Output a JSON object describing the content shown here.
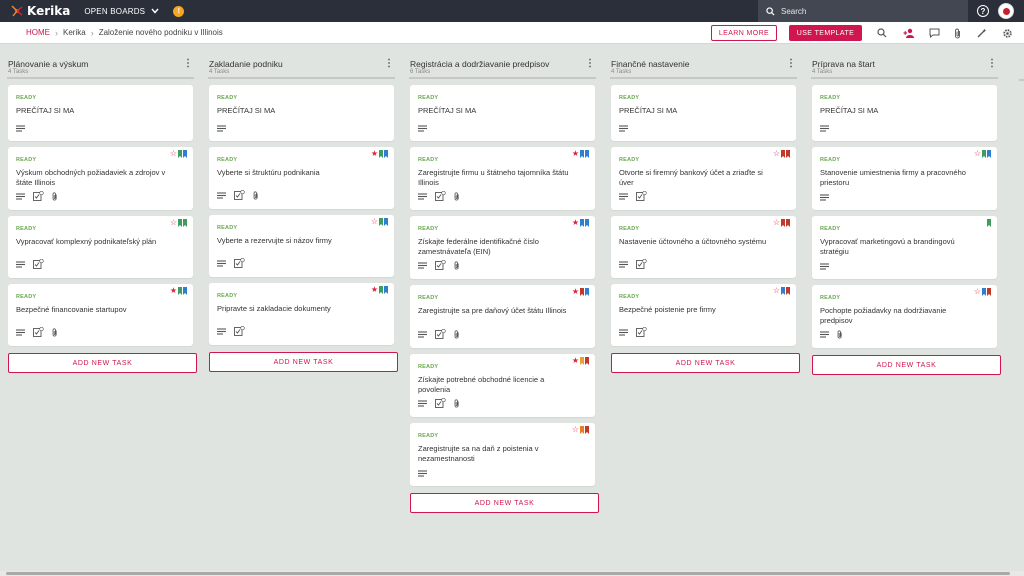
{
  "topbar": {
    "logo_text": "Kerika",
    "open_boards": "OPEN BOARDS",
    "search_placeholder": "Search",
    "help_label": "?"
  },
  "breadcrumb": [
    "HOME",
    "Kerika",
    "Založenie nového podniku v Illinois"
  ],
  "header_buttons": {
    "learn_more": "LEARN MORE",
    "use_template": "USE TEMPLATE"
  },
  "colors": {
    "accent": "#d0164f",
    "ready": "#6aa84f",
    "topbar": "#2b2f3a",
    "board_bg": "#dfe4e1"
  },
  "columns": [
    {
      "title": "Plánovanie a výskum",
      "count": "4 Tasks",
      "add_label": "ADD NEW TASK",
      "cards": [
        {
          "status": "READY",
          "title": "PREČÍTAJ SI MA",
          "star": null,
          "tags": [],
          "icons": [
            "notes-icon"
          ]
        },
        {
          "status": "READY",
          "title": "Výskum obchodných požiadaviek a zdrojov v štáte Illinois",
          "star": "empty",
          "tags": [
            "#3d9c5e",
            "#2f7fd1"
          ],
          "icons": [
            "notes-icon",
            "checklist-icon",
            "attachment-icon"
          ]
        },
        {
          "status": "READY",
          "title": "Vypracovať komplexný podnikateľský plán",
          "star": "empty",
          "tags": [
            "#3d9c5e",
            "#3d9c5e"
          ],
          "icons": [
            "notes-icon",
            "checklist-icon"
          ]
        },
        {
          "status": "READY",
          "title": "Bezpečné financovanie startupov",
          "star": "filled",
          "tags": [
            "#3d9c5e",
            "#2f7fd1"
          ],
          "icons": [
            "notes-icon",
            "checklist-icon",
            "attachment-icon"
          ]
        }
      ]
    },
    {
      "title": "Zakladanie podniku",
      "count": "4 Tasks",
      "add_label": "ADD NEW TASK",
      "cards": [
        {
          "status": "READY",
          "title": "PREČÍTAJ SI MA",
          "star": null,
          "tags": [],
          "icons": [
            "notes-icon"
          ]
        },
        {
          "status": "READY",
          "title": "Vyberte si štruktúru podnikania",
          "star": "filled",
          "tags": [
            "#3d9c5e",
            "#2f7fd1"
          ],
          "icons": [
            "notes-icon",
            "checklist-icon",
            "attachment-icon"
          ]
        },
        {
          "status": "READY",
          "title": "Vyberte a rezervujte si názov firmy",
          "star": "empty",
          "tags": [
            "#3d9c5e",
            "#2f7fd1"
          ],
          "icons": [
            "notes-icon",
            "checklist-icon"
          ]
        },
        {
          "status": "READY",
          "title": "Pripravte si zakladacie dokumenty",
          "star": "filled",
          "tags": [
            "#3d9c5e",
            "#2f7fd1"
          ],
          "icons": [
            "notes-icon",
            "checklist-icon"
          ]
        }
      ]
    },
    {
      "title": "Registrácia a dodržiavanie predpisov",
      "count": "6 Tasks",
      "add_label": "ADD NEW TASK",
      "cards": [
        {
          "status": "READY",
          "title": "PREČÍTAJ SI MA",
          "star": null,
          "tags": [],
          "icons": [
            "notes-icon"
          ]
        },
        {
          "status": "READY",
          "title": "Zaregistrujte firmu u štátneho tajomníka štátu Illinois",
          "star": "filled",
          "tags": [
            "#2f7fd1",
            "#2f7fd1"
          ],
          "icons": [
            "notes-icon",
            "checklist-icon",
            "attachment-icon"
          ]
        },
        {
          "status": "READY",
          "title": "Získajte federálne identifikačné číslo zamestnávateľa (EIN)",
          "star": "filled",
          "tags": [
            "#2f7fd1",
            "#2f7fd1"
          ],
          "icons": [
            "notes-icon",
            "checklist-icon",
            "attachment-icon"
          ]
        },
        {
          "status": "READY",
          "title": "Zaregistrujte sa pre daňový účet štátu Illinois",
          "star": "filled",
          "tags": [
            "#c0392b",
            "#2f7fd1"
          ],
          "icons": [
            "notes-icon",
            "checklist-icon",
            "attachment-icon"
          ]
        },
        {
          "status": "READY",
          "title": "Získajte potrebné obchodné licencie a povolenia",
          "star": "filled",
          "tags": [
            "#e6a12e",
            "#c0392b"
          ],
          "icons": [
            "notes-icon",
            "checklist-icon",
            "attachment-icon"
          ]
        },
        {
          "status": "READY",
          "title": "Zaregistrujte sa na daň z poistenia v nezamestnanosti",
          "star": "empty",
          "tags": [
            "#e67e22",
            "#c0392b"
          ],
          "icons": [
            "notes-icon"
          ]
        }
      ]
    },
    {
      "title": "Finančné nastavenie",
      "count": "4 Tasks",
      "add_label": "ADD NEW TASK",
      "cards": [
        {
          "status": "READY",
          "title": "PREČÍTAJ SI MA",
          "star": null,
          "tags": [],
          "icons": [
            "notes-icon"
          ]
        },
        {
          "status": "READY",
          "title": "Otvorte si firemný bankový účet a zriaďte si úver",
          "star": "empty",
          "tags": [
            "#c0392b",
            "#c0392b"
          ],
          "icons": [
            "notes-icon",
            "checklist-icon"
          ]
        },
        {
          "status": "READY",
          "title": "Nastavenie účtovného a účtovného systému",
          "star": "empty",
          "tags": [
            "#c0392b",
            "#c0392b"
          ],
          "icons": [
            "notes-icon",
            "checklist-icon"
          ]
        },
        {
          "status": "READY",
          "title": "Bezpečné poistenie pre firmy",
          "star": "empty",
          "tags": [
            "#2f7fd1",
            "#c0392b"
          ],
          "icons": [
            "notes-icon",
            "checklist-icon"
          ]
        }
      ]
    },
    {
      "title": "Príprava na štart",
      "count": "4 Tasks",
      "add_label": "ADD NEW TASK",
      "cards": [
        {
          "status": "READY",
          "title": "PREČÍTAJ SI MA",
          "star": null,
          "tags": [],
          "icons": [
            "notes-icon"
          ]
        },
        {
          "status": "READY",
          "title": "Stanovenie umiestnenia firmy a pracovného priestoru",
          "star": "empty",
          "tags": [
            "#3d9c5e",
            "#2f7fd1"
          ],
          "icons": [
            "notes-icon"
          ]
        },
        {
          "status": "READY",
          "title": "Vypracovať marketingovú a brandingovú stratégiu",
          "star": null,
          "tags": [
            "#3d9c5e"
          ],
          "icons": [
            "notes-icon"
          ]
        },
        {
          "status": "READY",
          "title": "Pochopte požiadavky na dodržiavanie predpisov",
          "star": "empty",
          "tags": [
            "#2f7fd1",
            "#c0392b"
          ],
          "icons": [
            "notes-icon",
            "attachment-icon"
          ]
        }
      ]
    }
  ]
}
